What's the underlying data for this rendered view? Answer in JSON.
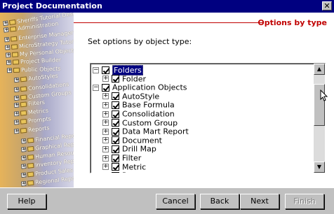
{
  "window": {
    "title": "Project Documentation",
    "close_glyph": "✕"
  },
  "header": {
    "title": "Options by type"
  },
  "main": {
    "set_label": "Set options by object type:"
  },
  "watermark": {
    "items": [
      "Sheriffs Tutorial Desk",
      "Administration",
      "Enterprise Manager Demo",
      "MicroStrategy Tutorial",
      "My Personal Objects",
      "Project Builder",
      "Public Objects",
      "AutoStyles",
      "Consolidations",
      "Custom Groups",
      "Filters",
      "Metrics",
      "Prompts",
      "Reports",
      "Financial Reports",
      "Graphical Reports",
      "Human Resources",
      "Inventory Reports",
      "Product Sales R",
      "Regional Reports"
    ]
  },
  "tree": {
    "items": [
      {
        "label": "Folders",
        "expander": "−",
        "checked": true,
        "selected": true
      },
      {
        "label": "Folder",
        "expander": "+",
        "checked": true
      },
      {
        "label": "Application Objects",
        "expander": "−",
        "checked": true
      },
      {
        "label": "AutoStyle",
        "expander": "+",
        "checked": true
      },
      {
        "label": "Base Formula",
        "expander": "+",
        "checked": true
      },
      {
        "label": "Consolidation",
        "expander": "+",
        "checked": true
      },
      {
        "label": "Custom Group",
        "expander": "+",
        "checked": true
      },
      {
        "label": "Data Mart Report",
        "expander": "+",
        "checked": true
      },
      {
        "label": "Document",
        "expander": "+",
        "checked": true
      },
      {
        "label": "Drill Map",
        "expander": "+",
        "checked": true
      },
      {
        "label": "Filter",
        "expander": "+",
        "checked": true
      },
      {
        "label": "Metric",
        "expander": "+",
        "checked": true
      },
      {
        "label": "Prompt",
        "expander": "+",
        "checked": true
      }
    ],
    "scroll_position": 0.2
  },
  "buttons": {
    "help": "Help",
    "cancel": "Cancel",
    "back": "Back",
    "next": "Next",
    "finish": "Finish"
  },
  "colors": {
    "title_bar": "#000080",
    "accent_red": "#c00000",
    "face": "#c0c0c0"
  },
  "icons": {
    "up": "up-arrow-icon",
    "down": "down-arrow-icon",
    "cursor": "resize-cursor-icon"
  }
}
